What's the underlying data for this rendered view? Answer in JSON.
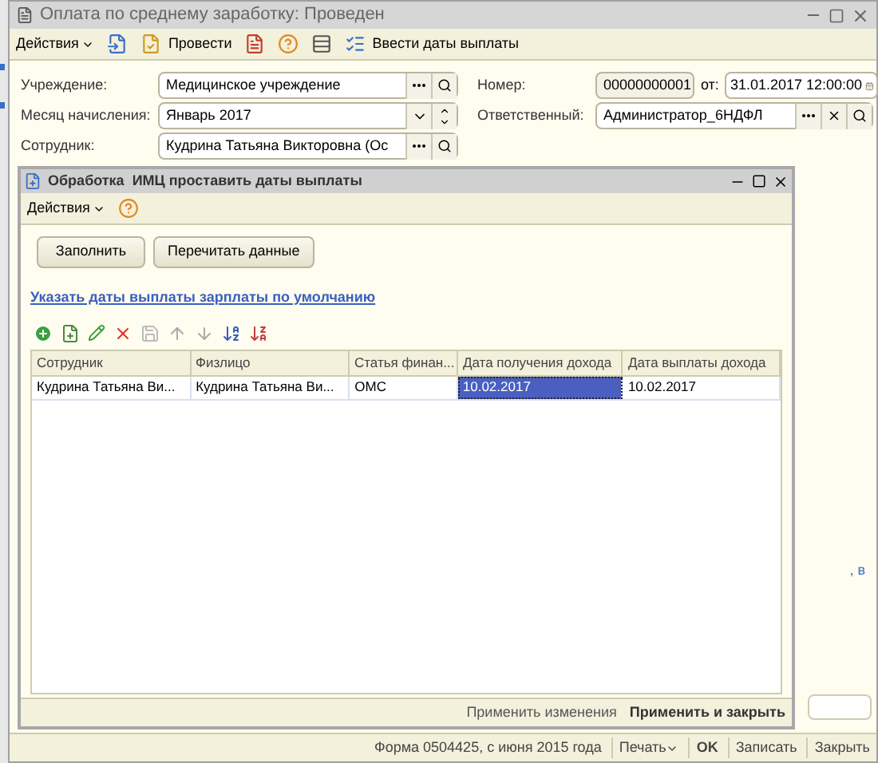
{
  "main_window": {
    "title": "Оплата по среднему заработку: Проведен",
    "toolbar": {
      "actions": "Действия",
      "post": "Провести",
      "enter_dates": "Ввести даты выплаты"
    },
    "left_fields": [
      {
        "label": "Учреждение:",
        "value": "Медицинское учреждение",
        "kind": "lookup"
      },
      {
        "label": "Месяц начисления:",
        "value": "Январь 2017",
        "kind": "month"
      },
      {
        "label": "Сотрудник:",
        "value": "Кудрина Татьяна Викторовна (Ос",
        "kind": "lookup"
      }
    ],
    "number": {
      "label": "Номер:",
      "value": "00000000001",
      "date_label": "от:",
      "date": "31.01.2017 12:00:00"
    },
    "responsible": {
      "label": "Ответственный:",
      "value": "Администратор_6НДФЛ"
    },
    "background_link": ", в",
    "footer": {
      "form_note": "Форма 0504425, с июня 2015 года",
      "print": "Печать",
      "ok": "OK",
      "save": "Записать",
      "close": "Закрыть"
    }
  },
  "dialog": {
    "title": "Обработка  ИМЦ проставить даты выплаты",
    "actions": "Действия",
    "buttons": [
      "Заполнить",
      "Перечитать данные"
    ],
    "link": "Указать даты выплаты зарплаты по умолчанию",
    "table": {
      "columns": [
        "Сотрудник",
        "Физлицо",
        "Статья финан...",
        "Дата получения дохода",
        "Дата выплаты дохода"
      ],
      "rows": [
        {
          "cells": [
            {
              "text": "Кудрина Татьяна Ви...",
              "selected": false
            },
            {
              "text": "Кудрина Татьяна Ви...",
              "selected": false
            },
            {
              "text": "ОМС",
              "selected": false
            },
            {
              "text": "10.02.2017",
              "selected": true
            },
            {
              "text": "10.02.2017",
              "selected": false
            }
          ]
        }
      ]
    },
    "footer": {
      "apply": "Применить изменения",
      "apply_close": "Применить и закрыть"
    }
  }
}
